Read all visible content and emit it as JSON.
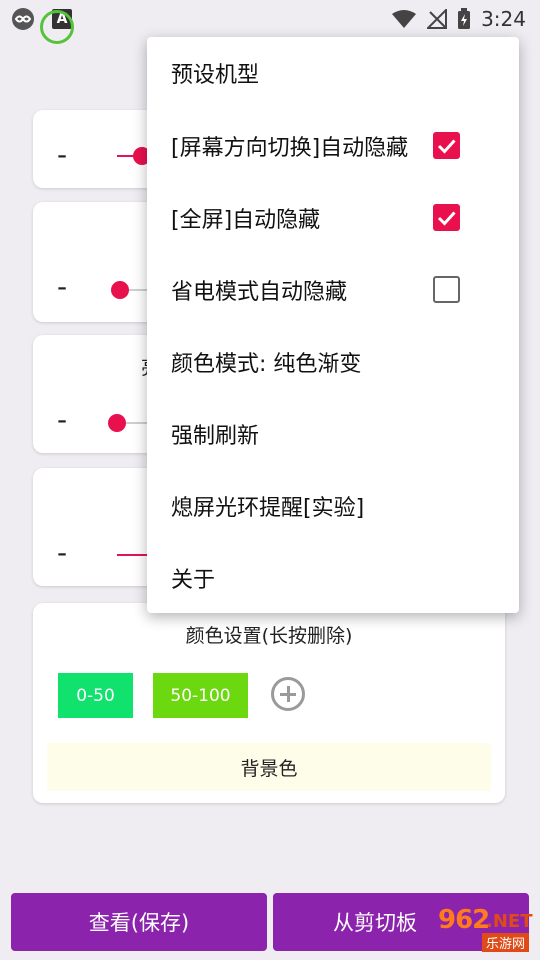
{
  "status_bar": {
    "time": "3:24",
    "app_icon_letter": "A"
  },
  "cards": {
    "minus_label": "-",
    "partial_label": "亮"
  },
  "color_settings": {
    "title": "颜色设置(长按删除)",
    "chips": [
      {
        "label": "0-50",
        "color": "#10e26d"
      },
      {
        "label": "50-100",
        "color": "#6cd810"
      }
    ],
    "background_label": "背景色"
  },
  "bottom_buttons": {
    "view_save": "查看(保存)",
    "from_clipboard": "从剪切板"
  },
  "menu": {
    "items": [
      {
        "label": "预设机型"
      },
      {
        "label": "[屏幕方向切换]自动隐藏",
        "checked": true
      },
      {
        "label": "[全屏]自动隐藏",
        "checked": true
      },
      {
        "label": "省电模式自动隐藏",
        "checked": false
      },
      {
        "label": "颜色模式: 纯色渐变"
      },
      {
        "label": "强制刷新"
      },
      {
        "label": "熄屏光环提醒[实验]"
      },
      {
        "label": "关于"
      }
    ]
  },
  "watermark": {
    "number": "962",
    "net": ".NET",
    "site": "乐游网"
  },
  "colors": {
    "accent": "#e8114e",
    "button": "#8b23ac"
  }
}
